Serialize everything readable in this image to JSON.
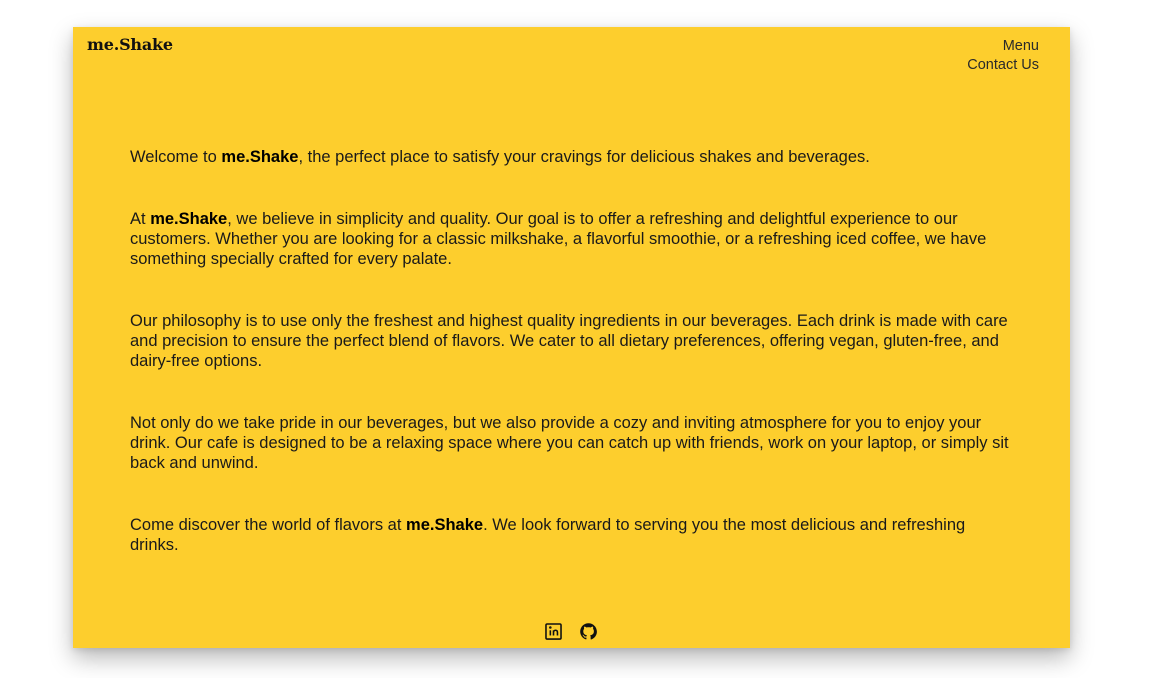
{
  "header": {
    "logo": "me.Shake",
    "nav": {
      "menu": "Menu",
      "contact": "Contact Us"
    }
  },
  "content": {
    "brand": "me.Shake",
    "p1": {
      "before": "Welcome to ",
      "after": ", the perfect place to satisfy your cravings for delicious shakes and beverages."
    },
    "p2": {
      "before": "At ",
      "after": ", we believe in simplicity and quality. Our goal is to offer a refreshing and delightful experience to our customers. Whether you are looking for a classic milkshake, a flavorful smoothie, or a refreshing iced coffee, we have something specially crafted for every palate."
    },
    "p3": "Our philosophy is to use only the freshest and highest quality ingredients in our beverages. Each drink is made with care and precision to ensure the perfect blend of flavors. We cater to all dietary preferences, offering vegan, gluten-free, and dairy-free options.",
    "p4": "Not only do we take pride in our beverages, but we also provide a cozy and inviting atmosphere for you to enjoy your drink. Our cafe is designed to be a relaxing space where you can catch up with friends, work on your laptop, or simply sit back and unwind.",
    "p5": {
      "before": "Come discover the world of flavors at ",
      "after": ". We look forward to serving you the most delicious and refreshing drinks."
    }
  },
  "footer": {
    "icons": [
      "linkedin-icon",
      "github-icon"
    ]
  },
  "colors": {
    "card_background": "#FDCE2D",
    "page_background": "#FFFFFF",
    "text": "#1A1A1A"
  }
}
